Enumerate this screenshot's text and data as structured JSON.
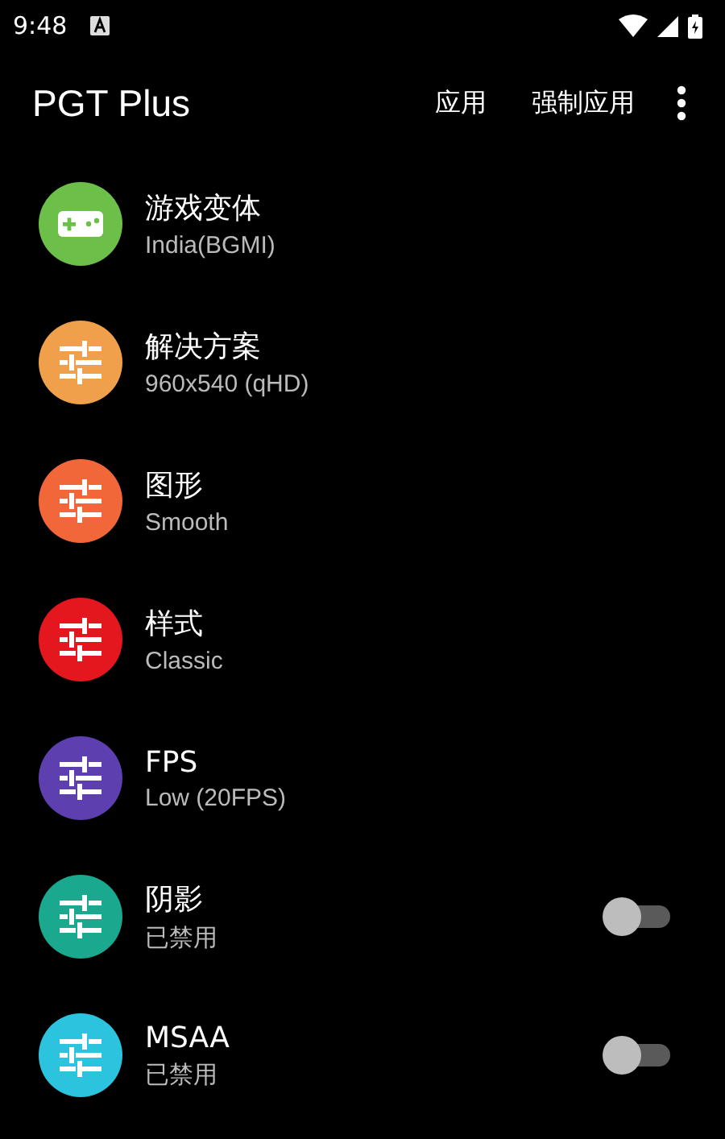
{
  "status_bar": {
    "time": "9:48"
  },
  "app_bar": {
    "title": "PGT Plus",
    "actions": [
      "应用",
      "强制应用"
    ]
  },
  "settings": [
    {
      "kind": "gamepad",
      "color": "#6cc04a",
      "title": "游戏变体",
      "value": "India(BGMI)"
    },
    {
      "kind": "sliders",
      "color": "#f0a04b",
      "title": "解决方案",
      "value": "960x540 (qHD)"
    },
    {
      "kind": "sliders",
      "color": "#f2673a",
      "title": "图形",
      "value": "Smooth"
    },
    {
      "kind": "sliders",
      "color": "#e3171d",
      "title": "样式",
      "value": "Classic"
    },
    {
      "kind": "sliders",
      "color": "#5e3fb0",
      "title": "FPS",
      "value": "Low (20FPS)"
    },
    {
      "kind": "sliders",
      "color": "#1aa88e",
      "title": "阴影",
      "value": "已禁用",
      "on": false
    },
    {
      "kind": "sliders",
      "color": "#2cc3de",
      "title": "MSAA",
      "value": "已禁用",
      "on": false
    }
  ]
}
